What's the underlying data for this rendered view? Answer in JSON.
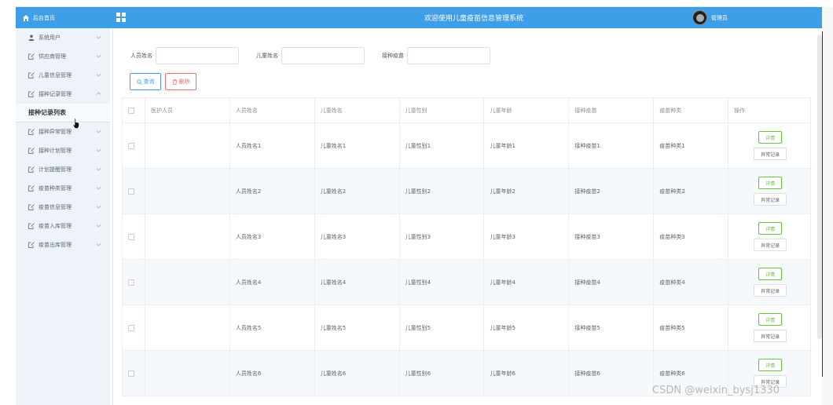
{
  "header": {
    "title": "欢迎使用儿童疫苗信息管理系统",
    "user": "管理员"
  },
  "sidebar": {
    "home": "后台首页",
    "items": [
      {
        "label": "系统用户",
        "icon": "user-icon",
        "expanded": false
      },
      {
        "label": "供应商管理",
        "icon": "edit-doc-icon",
        "expanded": false
      },
      {
        "label": "儿童信息管理",
        "icon": "edit-doc-icon",
        "expanded": false
      },
      {
        "label": "接种记录管理",
        "icon": "edit-doc-icon",
        "expanded": true
      }
    ],
    "submenu_active": "接种记录列表",
    "items_after": [
      {
        "label": "接种异常管理",
        "icon": "edit-doc-icon"
      },
      {
        "label": "接种计划管理",
        "icon": "edit-doc-icon"
      },
      {
        "label": "计划提醒管理",
        "icon": "edit-doc-icon"
      },
      {
        "label": "疫苗种类管理",
        "icon": "edit-doc-icon"
      },
      {
        "label": "疫苗信息管理",
        "icon": "edit-doc-icon"
      },
      {
        "label": "疫苗入库管理",
        "icon": "edit-doc-icon"
      },
      {
        "label": "疫苗出库管理",
        "icon": "edit-doc-icon"
      }
    ]
  },
  "search": {
    "fields": [
      {
        "label": "人员姓名",
        "value": ""
      },
      {
        "label": "儿童姓名",
        "value": ""
      },
      {
        "label": "接种疫苗",
        "value": ""
      }
    ],
    "query_label": "查询",
    "delete_label": "删除"
  },
  "table": {
    "columns": [
      "医护人员",
      "人员姓名",
      "儿童姓名",
      "儿童性别",
      "儿童年龄",
      "接种疫苗",
      "疫苗种类",
      "操作"
    ],
    "rows": [
      [
        "",
        "人员姓名1",
        "儿童姓名1",
        "儿童性别1",
        "儿童年龄1",
        "接种疫苗1",
        "疫苗种类1"
      ],
      [
        "",
        "人员姓名2",
        "儿童姓名2",
        "儿童性别2",
        "儿童年龄2",
        "接种疫苗2",
        "疫苗种类2"
      ],
      [
        "",
        "人员姓名3",
        "儿童姓名3",
        "儿童性别3",
        "儿童年龄3",
        "接种疫苗3",
        "疫苗种类3"
      ],
      [
        "",
        "人员姓名4",
        "儿童姓名4",
        "儿童性别4",
        "儿童年龄4",
        "接种疫苗4",
        "疫苗种类4"
      ],
      [
        "",
        "人员姓名5",
        "儿童姓名5",
        "儿童性别5",
        "儿童年龄5",
        "接种疫苗5",
        "疫苗种类5"
      ],
      [
        "",
        "人员姓名6",
        "儿童姓名6",
        "儿童性别6",
        "儿童年龄6",
        "接种疫苗6",
        "疫苗种类6"
      ]
    ],
    "detail_label": "详情",
    "record_label": "异常记录"
  },
  "watermark": "CSDN @weixin_bysj1330",
  "colors": {
    "accent": "#3f9ee8",
    "primary": "#409eff",
    "danger": "#f56c6c",
    "success": "#67c23a",
    "sidebar_bg": "#eef3f9"
  }
}
